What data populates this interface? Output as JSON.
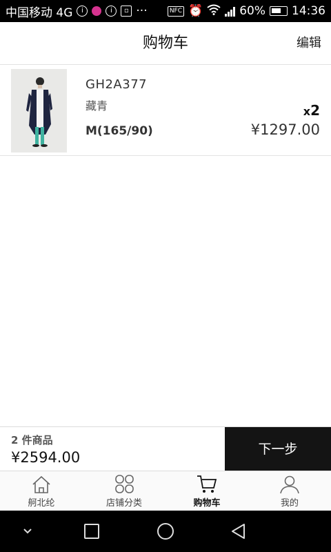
{
  "status_bar": {
    "carrier": "中国移动 4G",
    "battery": "60%",
    "time": "14:36",
    "nfc": "NFC"
  },
  "header": {
    "title": "购物车",
    "edit_label": "编辑"
  },
  "cart_items": [
    {
      "code": "GH2A377",
      "color": "藏青",
      "size": "M(165/90)",
      "qty_prefix": "x",
      "qty": "2",
      "price": "¥1297.00"
    }
  ],
  "summary": {
    "count_label": "2 件商品",
    "total": "¥2594.00",
    "next_label": "下一步"
  },
  "tabs": [
    {
      "label": "舸北纶",
      "icon": "home-icon",
      "active": false
    },
    {
      "label": "店铺分类",
      "icon": "category-icon",
      "active": false
    },
    {
      "label": "购物车",
      "icon": "cart-icon",
      "active": true
    },
    {
      "label": "我的",
      "icon": "profile-icon",
      "active": false
    }
  ],
  "colors": {
    "accent": "#141414",
    "divider": "#e2e2e2",
    "statusbar": "#000000"
  }
}
